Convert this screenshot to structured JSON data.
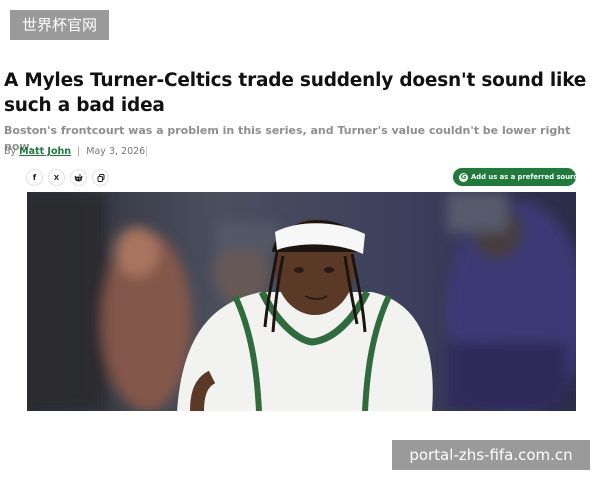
{
  "watermark": {
    "top": "世界杯官网",
    "bottom": "portal-zhs-fifa.com.cn"
  },
  "article": {
    "headline": "A Myles Turner-Celtics trade suddenly doesn't sound like such a bad idea",
    "dek": "Boston's frontcourt was a problem in this series, and Turner's value couldn't be lower right now.",
    "byline": {
      "prefix": "By",
      "author": "Matt John",
      "separator": "|",
      "date": "May 3, 2026"
    }
  },
  "share": {
    "icons": [
      "facebook-icon",
      "x-icon",
      "reddit-icon",
      "copy-link-icon"
    ],
    "facebook_glyph": "f",
    "x_glyph": "X"
  },
  "preferred_source": {
    "label": "Add us as a preferred source",
    "icon": "google-icon",
    "icon_glyph": "G",
    "color": "#1f7a3c"
  },
  "hero_image": {
    "subject": "basketball player with white headband in white jersey",
    "colors": {
      "background": "#3a3d4c",
      "jersey": "#f2f2f0",
      "trim": "#2f6b3c",
      "skin": "#5a3a27"
    }
  }
}
